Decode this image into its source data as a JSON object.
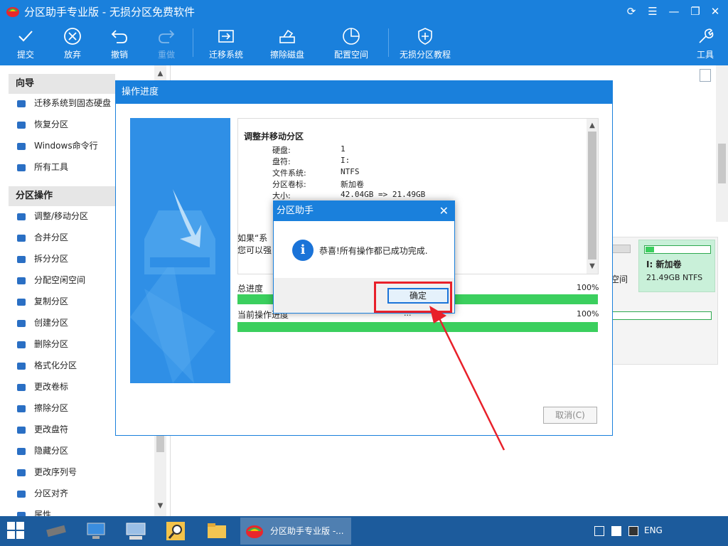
{
  "window": {
    "title": "分区助手专业版 - 无损分区免费软件",
    "controls": [
      "refresh-icon",
      "menu-icon",
      "minimize-icon",
      "restore-icon",
      "close-icon"
    ]
  },
  "toolbar": {
    "commit": "提交",
    "discard": "放弃",
    "undo": "撤销",
    "redo": "重做",
    "migrate": "迁移系统",
    "wipe": "擦除磁盘",
    "allocate": "配置空间",
    "tutorial": "无损分区教程",
    "tools": "工具"
  },
  "sidebar": {
    "wizard_header": "向导",
    "wizard_items": [
      {
        "label": "迁移系统到固态硬盘",
        "icon": "migrate-ssd-icon"
      },
      {
        "label": "恢复分区",
        "icon": "recover-icon"
      },
      {
        "label": "Windows命令行",
        "icon": "windows-icon"
      },
      {
        "label": "所有工具",
        "icon": "grid-icon"
      }
    ],
    "ops_header": "分区操作",
    "ops_items": [
      {
        "label": "调整/移动分区",
        "icon": "resize-icon"
      },
      {
        "label": "合并分区",
        "icon": "merge-icon"
      },
      {
        "label": "拆分分区",
        "icon": "split-icon"
      },
      {
        "label": "分配空闲空间",
        "icon": "allocate-icon"
      },
      {
        "label": "复制分区",
        "icon": "copy-icon"
      },
      {
        "label": "创建分区",
        "icon": "create-icon"
      },
      {
        "label": "删除分区",
        "icon": "delete-icon"
      },
      {
        "label": "格式化分区",
        "icon": "format-icon"
      },
      {
        "label": "更改卷标",
        "icon": "label-icon"
      },
      {
        "label": "擦除分区",
        "icon": "wipe-icon"
      },
      {
        "label": "更改盘符",
        "icon": "drive-letter-icon"
      },
      {
        "label": "隐藏分区",
        "icon": "hide-icon"
      },
      {
        "label": "更改序列号",
        "icon": "serial-icon"
      },
      {
        "label": "分区对齐",
        "icon": "align-icon"
      },
      {
        "label": "属性",
        "icon": "properties-icon"
      }
    ]
  },
  "disk_card": {
    "name": "I: 新加卷",
    "size": "21.49GB NTFS",
    "partial_label": "空间"
  },
  "progress_dialog": {
    "title": "操作进度",
    "log_heading": "调整并移动分区",
    "log_rows": [
      {
        "k": "硬盘:",
        "v": "1"
      },
      {
        "k": "盘符:",
        "v": "I:"
      },
      {
        "k": "文件系统:",
        "v": "NTFS"
      },
      {
        "k": "分区卷标:",
        "v": "新加卷"
      },
      {
        "k": "大小:",
        "v": "42.04GB => 21.49GB"
      }
    ],
    "note_line1": "如果“系",
    "note_line2": "您可以强",
    "total_label": "总进度",
    "total_pct": "100%",
    "total_value": 1.0,
    "current_label": "当前操作进度",
    "current_pct": "100%",
    "current_value": 1.0,
    "current_status": "...",
    "cancel": "取消(C)"
  },
  "message_box": {
    "title": "分区助手",
    "message": "恭喜!所有操作都已成功完成.",
    "ok": "确定"
  },
  "taskbar": {
    "app_label": "分区助手专业版 -...",
    "lang": "ENG"
  },
  "colors": {
    "primary": "#1a80dc",
    "progress_green": "#3bcf5e",
    "highlight_red": "#e8202a",
    "taskbar": "#1c5b9c"
  }
}
